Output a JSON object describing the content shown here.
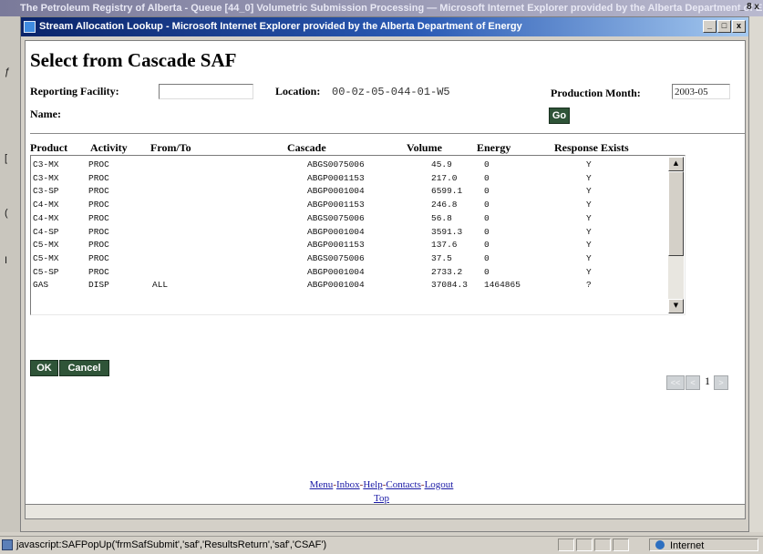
{
  "parent_window": {
    "title": "The Petroleum Registry of Alberta - Queue [44_0] Volumetric Submission Processing — Microsoft Internet Explorer provided by the Alberta Department of Energy",
    "controls": "_ 8 x",
    "status_text": "javascript:SAFPopUp('frmSafSubmit','saf','ResultsReturn','saf','CSAF')",
    "zone": "Internet"
  },
  "popup": {
    "title": "Stream Allocation Lookup - Microsoft Internet Explorer provided by the Alberta Department of Energy",
    "controls": {
      "minimize": "_",
      "maximize": "□",
      "close": "x"
    }
  },
  "page": {
    "heading": "Select from Cascade SAF",
    "reporting_facility_label": "Reporting Facility:",
    "reporting_facility_value": "",
    "location_label": "Location:",
    "location_value": "00-0z-05-044-01-W5",
    "production_month_label": "Production Month:",
    "production_month_value": "2003-05",
    "name_label": "Name:",
    "go_label": "Go"
  },
  "table": {
    "headers": [
      "Product",
      "Activity",
      "From/To",
      "Cascade",
      "Volume",
      "Energy",
      "Response Exists"
    ],
    "rows": [
      {
        "product": "C3-MX",
        "activity": "PROC",
        "from_to": "",
        "cascade": "ABGS0075006",
        "volume": "45.9",
        "energy": "0",
        "response": "Y"
      },
      {
        "product": "C3-MX",
        "activity": "PROC",
        "from_to": "",
        "cascade": "ABGP0001153",
        "volume": "217.0",
        "energy": "0",
        "response": "Y"
      },
      {
        "product": "C3-SP",
        "activity": "PROC",
        "from_to": "",
        "cascade": "ABGP0001004",
        "volume": "6599.1",
        "energy": "0",
        "response": "Y"
      },
      {
        "product": "C4-MX",
        "activity": "PROC",
        "from_to": "",
        "cascade": "ABGP0001153",
        "volume": "246.8",
        "energy": "0",
        "response": "Y"
      },
      {
        "product": "C4-MX",
        "activity": "PROC",
        "from_to": "",
        "cascade": "ABGS0075006",
        "volume": "56.8",
        "energy": "0",
        "response": "Y"
      },
      {
        "product": "C4-SP",
        "activity": "PROC",
        "from_to": "",
        "cascade": "ABGP0001004",
        "volume": "3591.3",
        "energy": "0",
        "response": "Y"
      },
      {
        "product": "C5-MX",
        "activity": "PROC",
        "from_to": "",
        "cascade": "ABGP0001153",
        "volume": "137.6",
        "energy": "0",
        "response": "Y"
      },
      {
        "product": "C5-MX",
        "activity": "PROC",
        "from_to": "",
        "cascade": "ABGS0075006",
        "volume": "37.5",
        "energy": "0",
        "response": "Y"
      },
      {
        "product": "C5-SP",
        "activity": "PROC",
        "from_to": "",
        "cascade": "ABGP0001004",
        "volume": "2733.2",
        "energy": "0",
        "response": "Y"
      },
      {
        "product": "GAS",
        "activity": "DISP",
        "from_to": "ALL",
        "cascade": "ABGP0001004",
        "volume": "37084.3",
        "energy": "1464865",
        "response": "?"
      }
    ]
  },
  "actions": {
    "ok_label": "OK",
    "cancel_label": "Cancel"
  },
  "pager": {
    "first": "<<",
    "prev": "<",
    "page": "1",
    "next": ">"
  },
  "footer": {
    "links": [
      "Menu",
      "Inbox",
      "Help",
      "Contacts",
      "Logout"
    ],
    "separator": "-",
    "top": "Top"
  },
  "colors": {
    "title_bar": "#0a246a",
    "dark_button": "#2f5438",
    "link": "#1a1aa6"
  }
}
